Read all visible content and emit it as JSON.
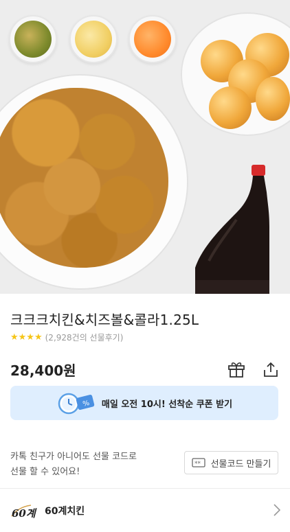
{
  "product": {
    "title": "크크크치킨&치즈볼&콜라1.25L",
    "rating_stars": "★★★★",
    "review_text": "(2,928건의 선물후기)",
    "price": "28,400원"
  },
  "coupon": {
    "text": "매일 오전 10시! 선착순 쿠폰 받기",
    "badge": "%"
  },
  "gift_code": {
    "line1": "카톡 친구가 아니어도 선물 코드로",
    "line2": "선물 할 수 있어요!",
    "button_label": "선물코드 만들기"
  },
  "brand": {
    "logo_text": "60계",
    "name": "60계치킨"
  },
  "colors": {
    "star": "#f5c518",
    "coupon_bg": "#dfeefe"
  },
  "icons": [
    "gift-icon",
    "share-icon",
    "alarm-clock-icon",
    "ticket-icon",
    "chevron-right-icon"
  ]
}
